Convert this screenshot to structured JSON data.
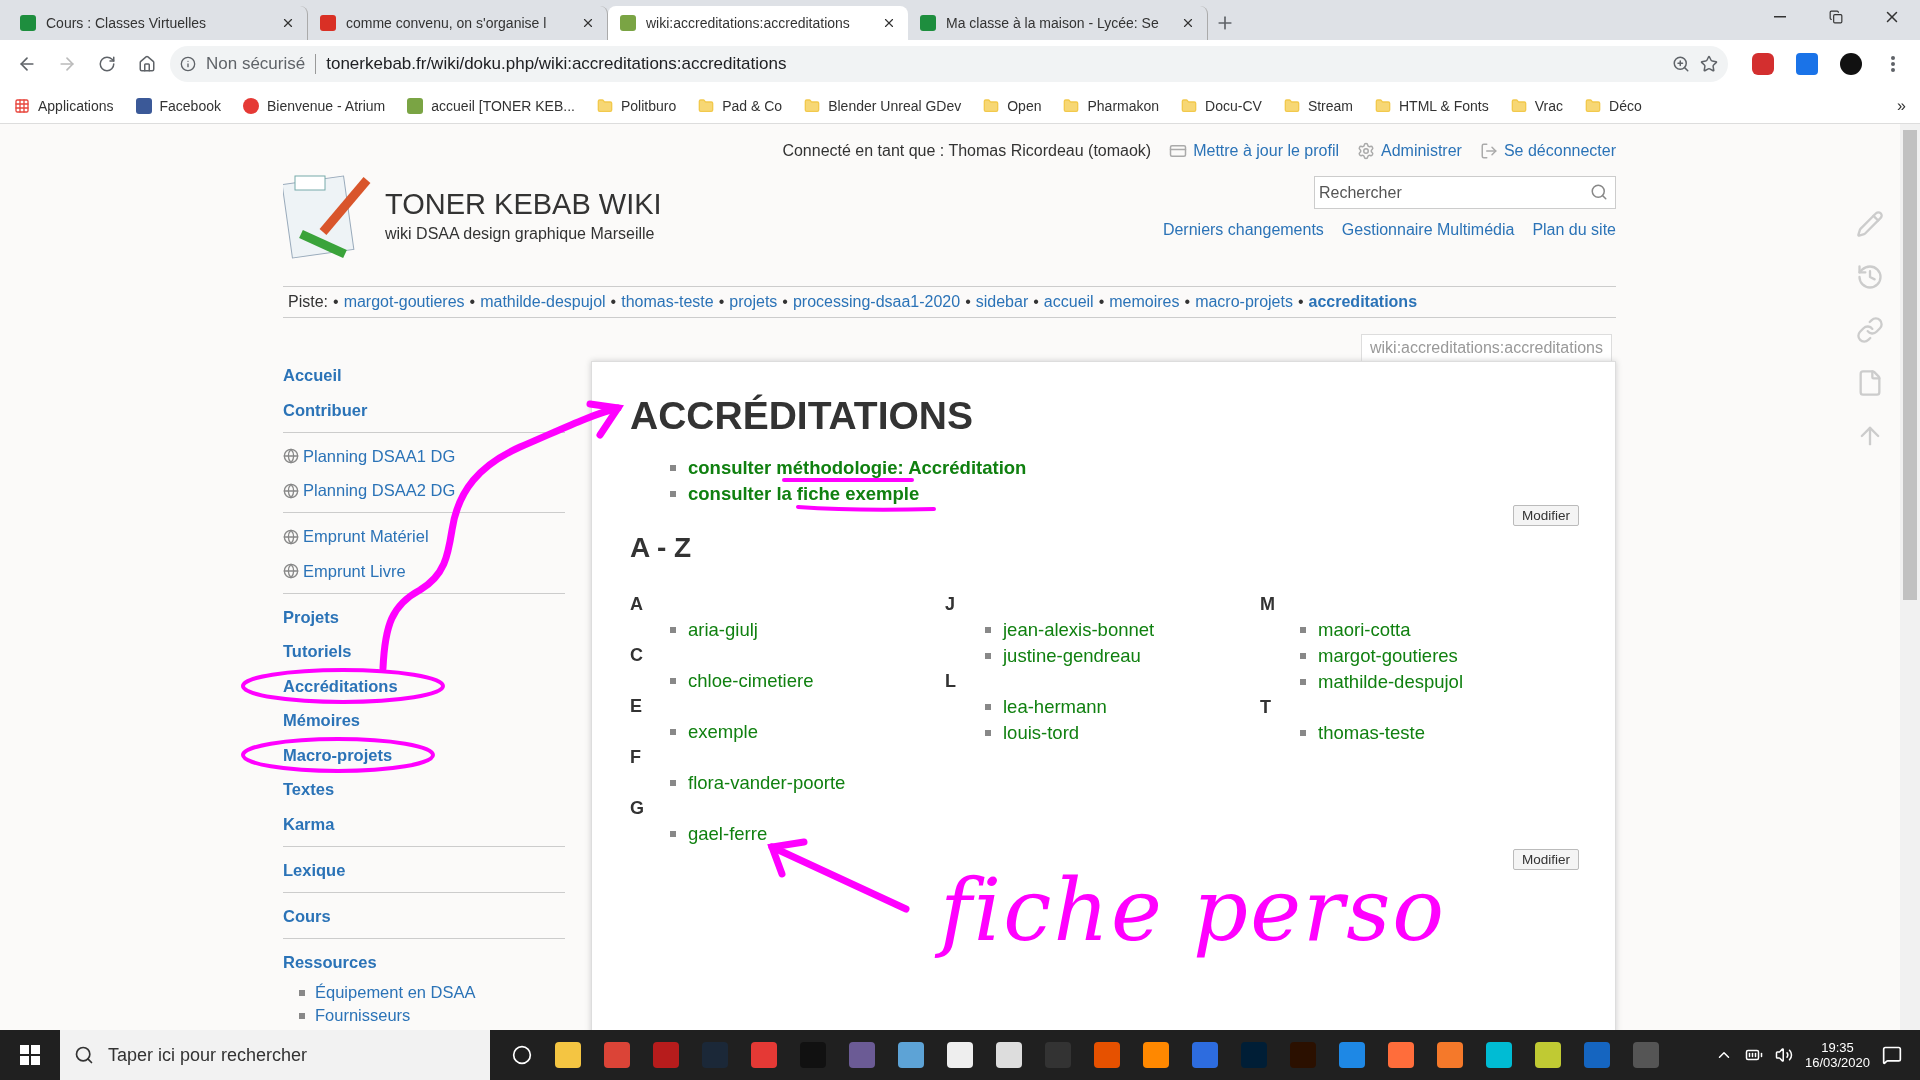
{
  "browser": {
    "tabs": [
      {
        "title": "Cours : Classes Virtuelles",
        "kind": "sheet",
        "selected": false
      },
      {
        "title": "comme convenu, on s'organise l",
        "kind": "mail",
        "selected": false
      },
      {
        "title": "wiki:accreditations:accreditations",
        "kind": "wiki",
        "selected": true
      },
      {
        "title": "Ma classe à la maison - Lycée: Se",
        "kind": "sheet",
        "selected": false
      }
    ],
    "address": {
      "security": "Non sécurisé",
      "url": "tonerkebab.fr/wiki/doku.php/wiki:accreditations:accreditations"
    },
    "bookmarks": [
      {
        "label": "Applications",
        "kind": "apps"
      },
      {
        "label": "Facebook",
        "kind": "facebook"
      },
      {
        "label": "Bienvenue - Atrium",
        "kind": "atrium"
      },
      {
        "label": "accueil [TONER KEB...",
        "kind": "wiki"
      },
      {
        "label": "Politburo",
        "kind": "folder"
      },
      {
        "label": "Pad & Co",
        "kind": "folder"
      },
      {
        "label": "Blender Unreal GDev",
        "kind": "folder"
      },
      {
        "label": "Open",
        "kind": "folder"
      },
      {
        "label": "Pharmakon",
        "kind": "folder"
      },
      {
        "label": "Docu-CV",
        "kind": "folder"
      },
      {
        "label": "Stream",
        "kind": "folder"
      },
      {
        "label": "HTML & Fonts",
        "kind": "folder"
      },
      {
        "label": "Vrac",
        "kind": "folder"
      },
      {
        "label": "Déco",
        "kind": "folder"
      }
    ],
    "bookmarks_more": "»"
  },
  "wiki": {
    "user_line": "Connecté en tant que : Thomas Ricordeau (tomaok)",
    "user_links": [
      {
        "label": "Mettre à jour le profil",
        "kind": "profile"
      },
      {
        "label": "Administrer",
        "kind": "admin"
      },
      {
        "label": "Se déconnecter",
        "kind": "logout"
      }
    ],
    "title": "TONER KEBAB WIKI",
    "tagline": "wiki DSAA design graphique Marseille",
    "search": {
      "placeholder": "Rechercher"
    },
    "site_links": [
      "Derniers changements",
      "Gestionnaire Multimédia",
      "Plan du site"
    ],
    "breadcrumb": {
      "label": "Piste:",
      "separator": "•",
      "items": [
        {
          "label": "margot-goutieres",
          "selected": false
        },
        {
          "label": "mathilde-despujol",
          "selected": false
        },
        {
          "label": "thomas-teste",
          "selected": false
        },
        {
          "label": "projets",
          "selected": false
        },
        {
          "label": "processing-dsaa1-2020",
          "selected": false
        },
        {
          "label": "sidebar",
          "selected": false
        },
        {
          "label": "accueil",
          "selected": false
        },
        {
          "label": "memoires",
          "selected": false
        },
        {
          "label": "macro-projets",
          "selected": false
        },
        {
          "label": "accreditations",
          "selected": true
        }
      ]
    }
  },
  "sidebar": {
    "groups": [
      [
        {
          "label": "Accueil",
          "kind": "link"
        },
        {
          "label": "Contribuer",
          "kind": "link"
        }
      ],
      [
        {
          "label": "Planning DSAA1 DG",
          "kind": "external"
        },
        {
          "label": "Planning DSAA2 DG",
          "kind": "external"
        }
      ],
      [
        {
          "label": "Emprunt Matériel",
          "kind": "external"
        },
        {
          "label": "Emprunt Livre",
          "kind": "external"
        }
      ],
      [
        {
          "label": "Projets",
          "kind": "link"
        },
        {
          "label": "Tutoriels",
          "kind": "link"
        },
        {
          "label": "Accréditations",
          "kind": "link"
        },
        {
          "label": "Mémoires",
          "kind": "link"
        },
        {
          "label": "Macro-projets",
          "kind": "link"
        },
        {
          "label": "Textes",
          "kind": "link"
        },
        {
          "label": "Karma",
          "kind": "link"
        }
      ],
      [
        {
          "label": "Lexique",
          "kind": "link"
        }
      ],
      [
        {
          "label": "Cours",
          "kind": "link"
        }
      ],
      [
        {
          "label": "Ressources",
          "kind": "link",
          "children": [
            {
              "label": "Équipement en DSAA",
              "kind": "sub"
            },
            {
              "label": "Fournisseurs",
              "kind": "sub"
            }
          ]
        }
      ]
    ]
  },
  "page": {
    "page_id": "wiki:accreditations:accreditations",
    "heading": "ACCRÉDITATIONS",
    "intro": [
      {
        "text": "consulter",
        "link": "méthodologie: Accréditation"
      },
      {
        "text": "consulter la",
        "link": "fiche exemple"
      }
    ],
    "edit_buttons": [
      "Modifier",
      "Modifier"
    ],
    "az_heading": "A - Z",
    "columns": [
      [
        {
          "letter": "A",
          "items": [
            "aria-giulj"
          ]
        },
        {
          "letter": "C",
          "items": [
            "chloe-cimetiere"
          ]
        },
        {
          "letter": "E",
          "items": [
            "exemple"
          ]
        },
        {
          "letter": "F",
          "items": [
            "flora-vander-poorte"
          ]
        },
        {
          "letter": "G",
          "items": [
            "gael-ferre"
          ]
        }
      ],
      [
        {
          "letter": "J",
          "items": [
            "jean-alexis-bonnet",
            "justine-gendreau"
          ]
        },
        {
          "letter": "L",
          "items": [
            "lea-hermann",
            "louis-tord"
          ]
        }
      ],
      [
        {
          "letter": "M",
          "items": [
            "maori-cotta",
            "margot-goutieres",
            "mathilde-despujol"
          ]
        },
        {
          "letter": "T",
          "items": [
            "thomas-teste"
          ]
        }
      ]
    ]
  },
  "annotation": {
    "handwriting": "fiche perso"
  },
  "taskbar": {
    "search_placeholder": "Taper ici pour rechercher",
    "time": "19:35",
    "date": "16/03/2020"
  }
}
